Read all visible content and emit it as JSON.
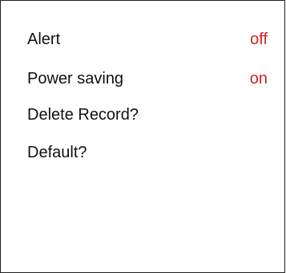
{
  "colors": {
    "label": "#111111",
    "value": "#d42020",
    "border": "#222222",
    "background": "#ffffff"
  },
  "menu": {
    "items": [
      {
        "label": "Alert",
        "value": "off"
      },
      {
        "label": "Power saving",
        "value": "on"
      },
      {
        "label": "Delete Record?"
      },
      {
        "label": "Default?"
      }
    ]
  }
}
